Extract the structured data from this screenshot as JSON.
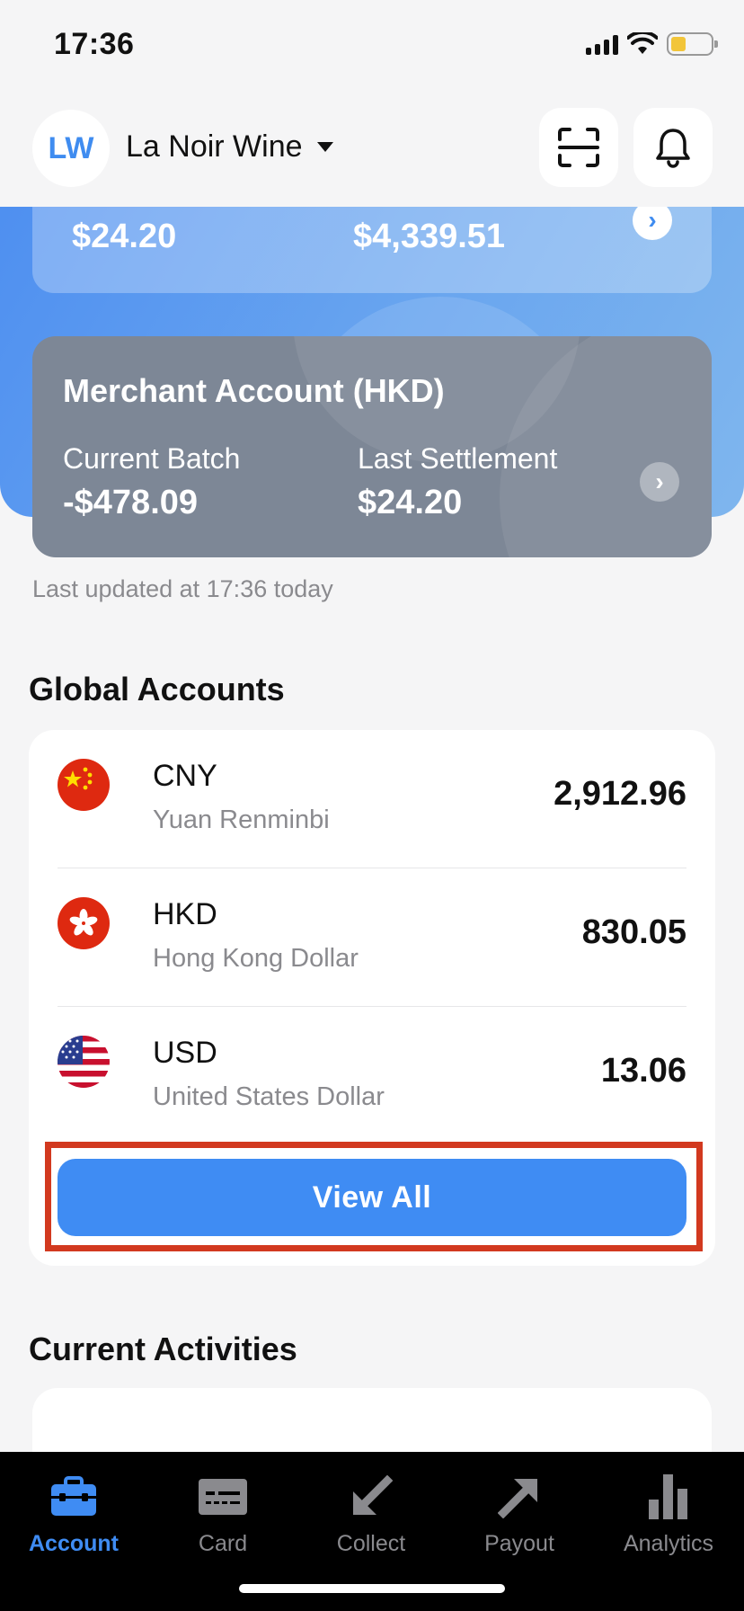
{
  "status_bar": {
    "time": "17:36"
  },
  "header": {
    "avatar_initials": "LW",
    "merchant_name": "La Noir Wine"
  },
  "top_card": {
    "amount_left": "$24.20",
    "amount_right": "$4,339.51"
  },
  "merchant_card": {
    "title": "Merchant Account (HKD)",
    "current_batch_label": "Current Batch",
    "current_batch_value": "-$478.09",
    "last_settlement_label": "Last Settlement",
    "last_settlement_value": "$24.20"
  },
  "last_updated": "Last updated at 17:36 today",
  "global_accounts": {
    "title": "Global Accounts",
    "accounts": [
      {
        "code": "CNY",
        "name": "Yuan Renminbi",
        "amount": "2,912.96",
        "flag": "china-flag-icon"
      },
      {
        "code": "HKD",
        "name": "Hong Kong Dollar",
        "amount": "830.05",
        "flag": "hong-kong-flag-icon"
      },
      {
        "code": "USD",
        "name": "United States Dollar",
        "amount": "13.06",
        "flag": "us-flag-icon"
      }
    ],
    "view_all_label": "View All"
  },
  "current_activities": {
    "title": "Current Activities"
  },
  "tab_bar": {
    "tabs": [
      {
        "label": "Account",
        "icon": "briefcase-icon",
        "active": true
      },
      {
        "label": "Card",
        "icon": "card-icon",
        "active": false
      },
      {
        "label": "Collect",
        "icon": "arrow-down-left-icon",
        "active": false
      },
      {
        "label": "Payout",
        "icon": "arrow-up-right-icon",
        "active": false
      },
      {
        "label": "Analytics",
        "icon": "bar-chart-icon",
        "active": false
      }
    ]
  },
  "colors": {
    "accent": "#3f8cf3",
    "highlight_outline": "#d2391f",
    "merchant_card": "#7d8796",
    "hero_blue": "#4e8ff0"
  }
}
